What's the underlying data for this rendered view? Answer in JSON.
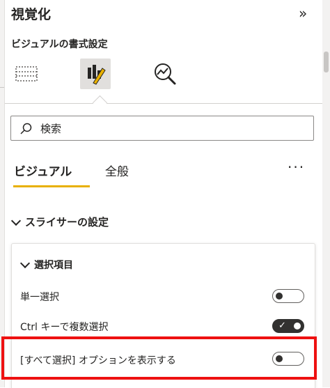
{
  "pane": {
    "title": "視覚化",
    "subtitle": "ビジュアルの書式設定",
    "collapse_label": "»"
  },
  "icons": {
    "build": "build-visual-icon",
    "format": "format-visual-icon",
    "analytics": "analytics-icon"
  },
  "search": {
    "placeholder": "検索"
  },
  "tabs": [
    {
      "label": "ビジュアル",
      "active": true
    },
    {
      "label": "全般",
      "active": false
    }
  ],
  "more_label": "···",
  "section": {
    "title": "スライサーの設定",
    "card": {
      "title": "選択項目",
      "rows": [
        {
          "label": "単一選択",
          "on": false
        },
        {
          "label": "Ctrl キーで複数選択",
          "on": true
        },
        {
          "label": "[すべて選択] オプションを表示する",
          "on": false
        }
      ]
    }
  },
  "colors": {
    "accent": "#e8b000",
    "highlight": "#ee1111",
    "toggle_on": "#323130"
  }
}
